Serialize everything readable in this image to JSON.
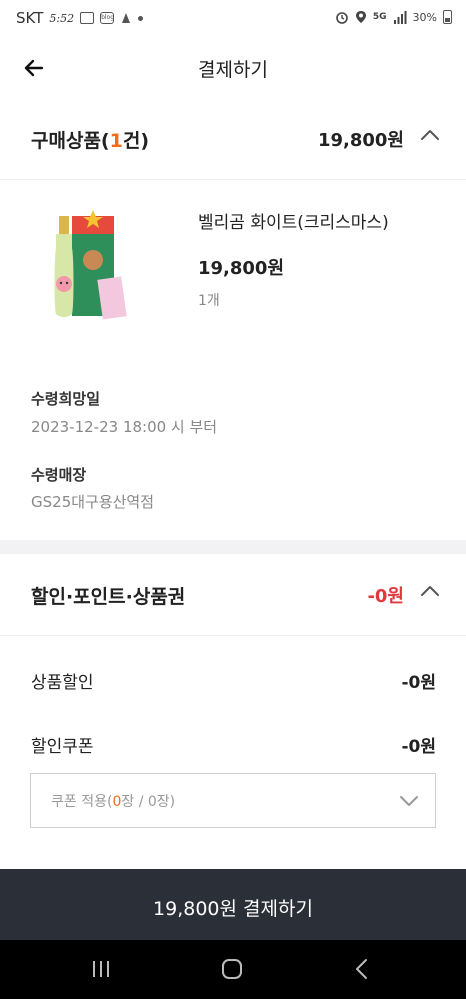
{
  "status_bar": {
    "carrier": "SKT",
    "time": "5:52",
    "talk_icon_text": "blog",
    "network": "5G",
    "battery": "30%"
  },
  "header": {
    "title": "결제하기"
  },
  "purchase_section": {
    "title_prefix": "구매상품(",
    "count": "1",
    "title_suffix": "건)",
    "amount": "19,800원"
  },
  "product": {
    "name": "벨리곰 화이트(크리스마스)",
    "price": "19,800원",
    "quantity": "1개",
    "image_icon": "wine-bottle-gift-box"
  },
  "pickup": {
    "date_label": "수령희망일",
    "date_value": "2023-12-23 18:00 시 부터",
    "store_label": "수령매장",
    "store_value": "GS25대구용산역점"
  },
  "discount_section": {
    "title": "할인·포인트·상품권",
    "amount": "-0원",
    "product_discount_label": "상품할인",
    "product_discount_value": "-0원",
    "coupon_label": "할인쿠폰",
    "coupon_value": "-0원",
    "coupon_select": {
      "prefix": "쿠폰 적용(",
      "applied": "0",
      "suffix": "장 / 0장)"
    }
  },
  "pay_button": {
    "label": "19,800원 결제하기"
  },
  "colors": {
    "accent": "#f26b21",
    "discount_red": "#e0393e",
    "pay_bar": "#2b2f38"
  }
}
